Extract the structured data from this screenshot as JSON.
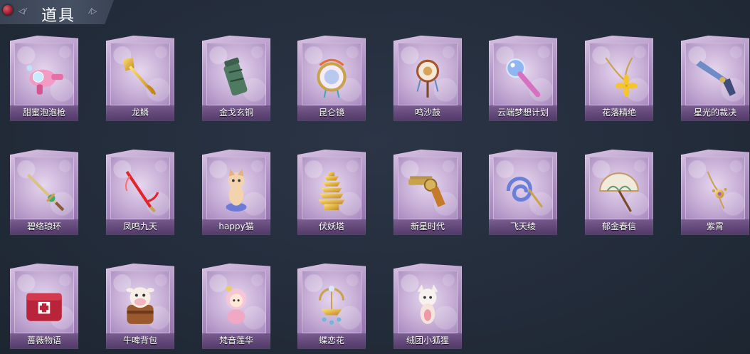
{
  "header": {
    "title": "道具"
  },
  "items": [
    {
      "name": "甜蜜泡泡枪",
      "icon": "bubble-gun-icon"
    },
    {
      "name": "龙鳞",
      "icon": "golden-shovel-icon"
    },
    {
      "name": "金戈玄铜",
      "icon": "bronze-cylinder-icon"
    },
    {
      "name": "昆仑镜",
      "icon": "ornate-mirror-icon"
    },
    {
      "name": "鸣沙鼓",
      "icon": "hand-drum-icon"
    },
    {
      "name": "云端梦想计划",
      "icon": "microphone-wand-icon"
    },
    {
      "name": "花落精绝",
      "icon": "flower-pendulum-icon"
    },
    {
      "name": "星光的裁决",
      "icon": "flintlock-pistol-icon"
    },
    {
      "name": "碧络琅环",
      "icon": "jade-sword-icon"
    },
    {
      "name": "凤鸣九天",
      "icon": "red-sword-icon"
    },
    {
      "name": "happy猫",
      "icon": "cat-figure-icon"
    },
    {
      "name": "伏妖塔",
      "icon": "golden-pagoda-icon"
    },
    {
      "name": "新星时代",
      "icon": "revolver-icon"
    },
    {
      "name": "飞天绫",
      "icon": "ribbon-icon"
    },
    {
      "name": "郁金春信",
      "icon": "paper-umbrella-icon"
    },
    {
      "name": "紫霄",
      "icon": "golden-pendulum-icon"
    },
    {
      "name": "蔷薇物语",
      "icon": "first-aid-kit-icon"
    },
    {
      "name": "牛啤背包",
      "icon": "cow-backpack-icon"
    },
    {
      "name": "梵音莲华",
      "icon": "doll-figure-icon"
    },
    {
      "name": "蝶恋花",
      "icon": "chandelier-icon"
    },
    {
      "name": "绒团小狐狸",
      "icon": "fox-plush-icon"
    }
  ],
  "colors": {
    "background": "#232c3a",
    "card": "#bba0cd",
    "label": "#ffffff"
  }
}
